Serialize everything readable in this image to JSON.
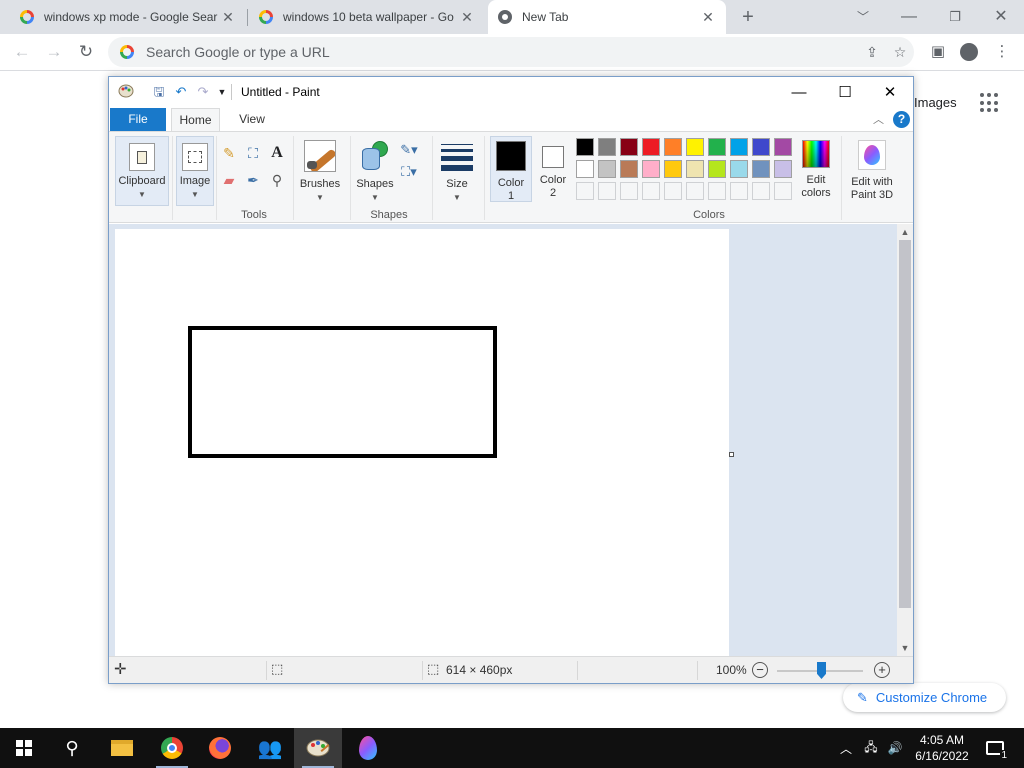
{
  "chrome": {
    "tabs": [
      {
        "title": "windows xp mode - Google Sear",
        "icon": "google-icon",
        "active": false
      },
      {
        "title": "windows 10 beta wallpaper - Go",
        "icon": "google-icon",
        "active": false
      },
      {
        "title": "New Tab",
        "icon": "chrome-icon",
        "active": true
      }
    ],
    "new_tab_symbol": "+",
    "omnibox_placeholder": "Search Google or type a URL",
    "ntp": {
      "images_link": "Images",
      "customize_label": "Customize Chrome"
    }
  },
  "paint": {
    "title": "Untitled - Paint",
    "ribbon_tabs": [
      "File",
      "Home",
      "View"
    ],
    "groups": {
      "clipboard": "Clipboard",
      "image": "Image",
      "tools": "Tools",
      "brushes": "Brushes",
      "shapes": "Shapes",
      "size": "Size",
      "color1": "Color 1",
      "color2": "Color 2",
      "colors": "Colors",
      "edit_colors": "Edit colors",
      "paint3d": "Edit with Paint 3D"
    },
    "color1_hex": "#000000",
    "color2_hex": "#ffffff",
    "palette_row1": [
      "#000000",
      "#7f7f7f",
      "#880015",
      "#ed1c24",
      "#ff7f27",
      "#fff200",
      "#22b14c",
      "#00a2e8",
      "#3f48cc",
      "#a349a4"
    ],
    "palette_row2": [
      "#ffffff",
      "#c3c3c3",
      "#b97a57",
      "#ffaec9",
      "#ffc90e",
      "#efe4b0",
      "#b5e61d",
      "#99d9ea",
      "#7092be",
      "#c8bfe7"
    ],
    "status": {
      "canvas_size": "614 × 460px",
      "zoom": "100%"
    }
  },
  "taskbar": {
    "time": "4:05 AM",
    "date": "6/16/2022",
    "notification_count": "1"
  },
  "colors": {
    "accent": "#1979ca",
    "chrome_frame": "#dee1e6"
  }
}
